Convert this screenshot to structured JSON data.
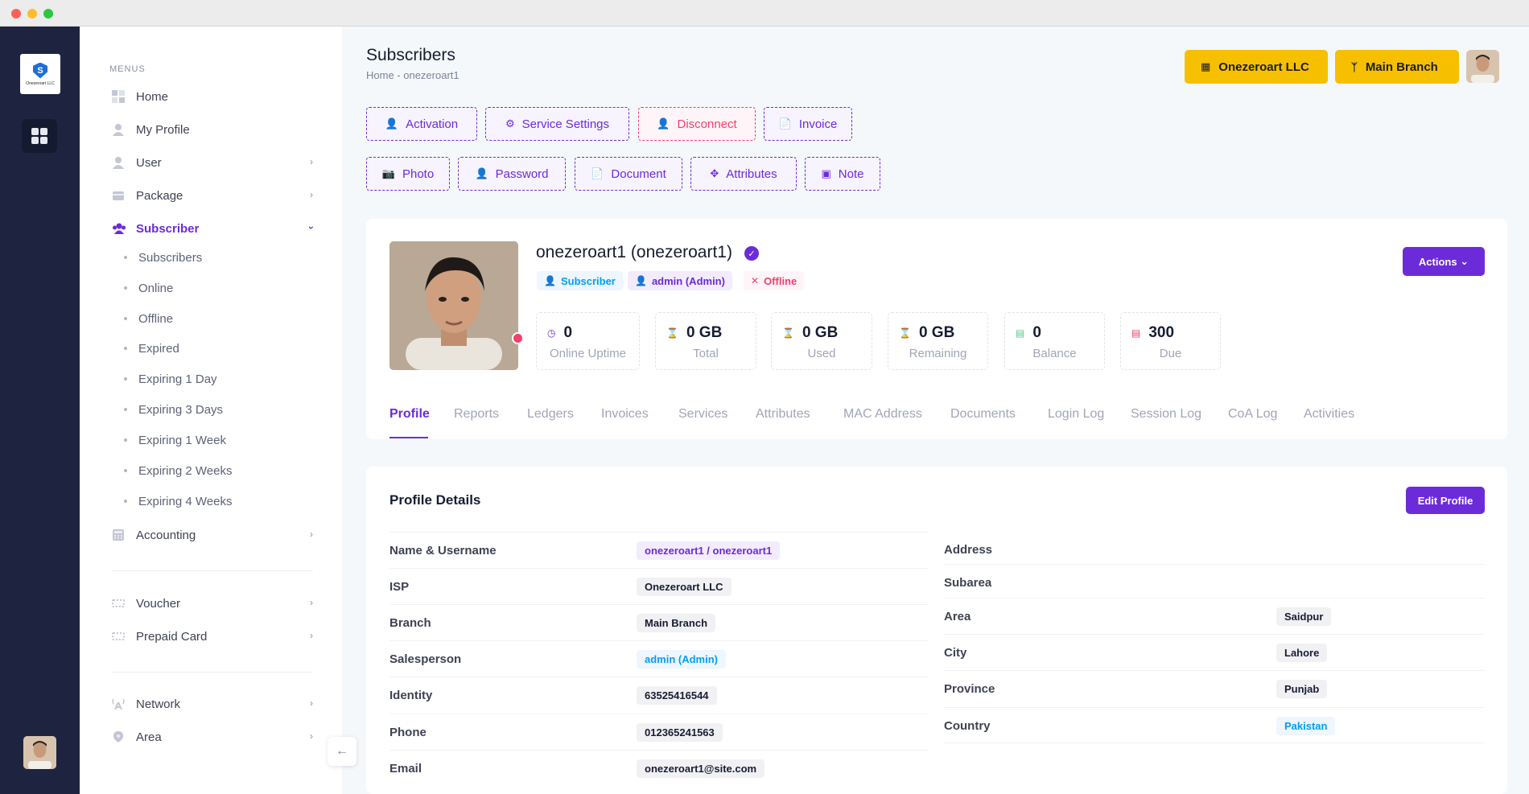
{
  "sidebar": {
    "menus_label": "MENUS",
    "items": [
      {
        "label": "Home",
        "icon": "grid-icon"
      },
      {
        "label": "My Profile",
        "icon": "person-icon"
      },
      {
        "label": "User",
        "icon": "person-icon"
      },
      {
        "label": "Package",
        "icon": "box-icon"
      },
      {
        "label": "Subscriber",
        "icon": "users-icon"
      },
      {
        "label": "Accounting",
        "icon": "calculator-icon"
      },
      {
        "label": "Voucher",
        "icon": "ticket-icon"
      },
      {
        "label": "Prepaid Card",
        "icon": "card-icon"
      },
      {
        "label": "Network",
        "icon": "antenna-icon"
      },
      {
        "label": "Area",
        "icon": "location-icon"
      }
    ],
    "subscriber_sub": [
      "Subscribers",
      "Online",
      "Offline",
      "Expired",
      "Expiring 1 Day",
      "Expiring 3 Days",
      "Expiring 1 Week",
      "Expiring 2 Weeks",
      "Expiring 4 Weeks"
    ]
  },
  "rail": {
    "logo_text": "Onezeroart LLC"
  },
  "header": {
    "title": "Subscribers",
    "breadcrumb": "Home  -  onezeroart1",
    "company_btn": "Onezeroart LLC",
    "branch_btn": "Main Branch"
  },
  "action_buttons": {
    "activation": "Activation",
    "service_settings": "Service Settings",
    "disconnect": "Disconnect",
    "invoice": "Invoice",
    "photo": "Photo",
    "password": "Password",
    "document": "Document",
    "attributes": "Attributes",
    "note": "Note"
  },
  "profile": {
    "name": "onezeroart1 (onezeroart1)",
    "badge_subscriber": "Subscriber",
    "badge_admin": "admin (Admin)",
    "badge_offline": "Offline",
    "actions_label": "Actions",
    "stats": [
      {
        "value": "0",
        "label": "Online Uptime",
        "color": "#6c2bd9"
      },
      {
        "value": "0 GB",
        "label": "Total",
        "color": "#50cd89"
      },
      {
        "value": "0 GB",
        "label": "Used",
        "color": "#f1416c"
      },
      {
        "value": "0 GB",
        "label": "Remaining",
        "color": "#f6c000"
      },
      {
        "value": "0",
        "label": "Balance",
        "color": "#50cd89"
      },
      {
        "value": "300",
        "label": "Due",
        "color": "#f1416c"
      }
    ]
  },
  "tabs": [
    "Profile",
    "Reports",
    "Ledgers",
    "Invoices",
    "Services",
    "Attributes",
    "MAC Address",
    "Documents",
    "Login Log",
    "Session Log",
    "CoA Log",
    "Activities"
  ],
  "details": {
    "title": "Profile Details",
    "edit_label": "Edit Profile",
    "left": [
      {
        "key": "Name & Username",
        "value": "onezeroart1 / onezeroart1"
      },
      {
        "key": "ISP",
        "value": "Onezeroart LLC"
      },
      {
        "key": "Branch",
        "value": "Main Branch"
      },
      {
        "key": "Salesperson",
        "value": "admin (Admin)"
      },
      {
        "key": "Identity",
        "value": "63525416544"
      },
      {
        "key": "Phone",
        "value": "012365241563"
      },
      {
        "key": "Email",
        "value": "onezeroart1@site.com"
      }
    ],
    "right": [
      {
        "key": "Address",
        "value": ""
      },
      {
        "key": "Subarea",
        "value": ""
      },
      {
        "key": "Area",
        "value": "Saidpur"
      },
      {
        "key": "City",
        "value": "Lahore"
      },
      {
        "key": "Province",
        "value": "Punjab"
      },
      {
        "key": "Country",
        "value": "Pakistan"
      }
    ]
  },
  "colors": {
    "accent": "#6c2bd9",
    "warning": "#f6c000",
    "danger": "#f1416c",
    "info": "#009ef7",
    "rail": "#1e2440"
  }
}
